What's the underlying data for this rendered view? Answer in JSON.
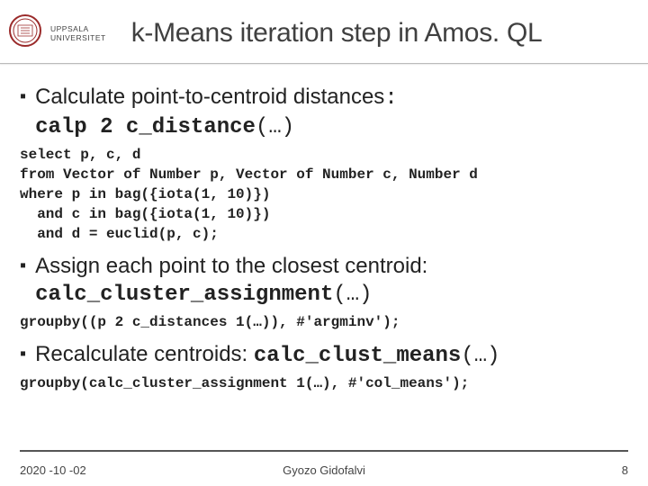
{
  "header": {
    "university": "UPPSALA",
    "university2": "UNIVERSITET",
    "title": "k-Means iteration step in Amos. QL"
  },
  "b1": {
    "text_a": "Calculate point-to-centroid distances",
    "colon": ":",
    "fn": "calp 2 c_distance",
    "args": "(…)"
  },
  "code1": "select p, c, d\nfrom Vector of Number p, Vector of Number c, Number d\nwhere p in bag({iota(1, 10)})\n  and c in bag({iota(1, 10)})\n  and d = euclid(p, c);",
  "b2": {
    "text_a": "Assign each point to the closest centroid:",
    "fn": "calc_cluster_assignment",
    "args": "(…)"
  },
  "code2": "groupby((p 2 c_distances 1(…)), #'argminv');",
  "b3": {
    "text_a": "Recalculate centroids: ",
    "fn": "calc_clust_means",
    "args": "(…)"
  },
  "code3": "groupby(calc_cluster_assignment 1(…), #'col_means');",
  "footer": {
    "date": "2020 -10 -02",
    "author": "Gyozo Gidofalvi",
    "page": "8"
  }
}
